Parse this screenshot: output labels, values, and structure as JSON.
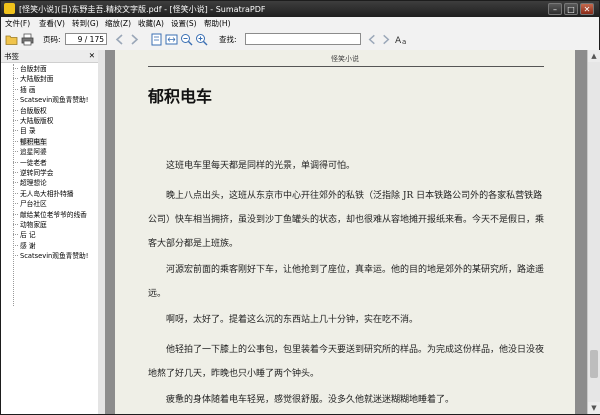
{
  "window": {
    "title": "[怪笑小说](日)东野圭吾.精校文字版.pdf - [怪笑小说] - SumatraPDF"
  },
  "menu": [
    "文件(F)",
    "查看(V)",
    "转到(G)",
    "缩放(Z)",
    "收藏(A)",
    "设置(S)",
    "帮助(H)"
  ],
  "toolbar": {
    "page_label": "页码:",
    "page_value": "9 / 175",
    "find_label": "查找:",
    "find_value": ""
  },
  "sidebar": {
    "title": "书签",
    "items": [
      {
        "label": "台版封面"
      },
      {
        "label": "大陆版封面"
      },
      {
        "label": "插 画"
      },
      {
        "label": "Scatsevin观鱼青赞助!"
      },
      {
        "label": "台版版权"
      },
      {
        "label": "大陆版版权"
      },
      {
        "label": "目 录"
      },
      {
        "label": "郁积电车",
        "selected": true
      },
      {
        "label": "追星阿婆"
      },
      {
        "label": "一徒老者"
      },
      {
        "label": "逆转同学会"
      },
      {
        "label": "超理想论"
      },
      {
        "label": "无人岛大相扑特播"
      },
      {
        "label": "尸台社区"
      },
      {
        "label": "献给某位老爷爷的线香"
      },
      {
        "label": "动物家庭"
      },
      {
        "label": "后 记"
      },
      {
        "label": "感 谢"
      },
      {
        "label": "Scatsevin观鱼青赞助!"
      }
    ]
  },
  "document": {
    "running_head": "怪笑小说",
    "chapter_title": "郁积电车",
    "paragraphs": [
      "这班电车里每天都是同样的光景，单调得可怕。",
      "晚上八点出头，这班从东京市中心开往郊外的私铁（泛指除 JR 日本铁路公司外的各家私营铁路公司）快车相当拥挤，虽没到沙丁鱼罐头的状态，却也很难从容地摊开报纸来看。今天不是假日，乘客大部分都是上班族。",
      "河源宏前面的乘客刚好下车，让他抢到了座位，真幸运。他的目的地是郊外的某研究所，路途遥远。",
      "啊呀，太好了。提着这么沉的东西站上几十分钟，实在吃不消。",
      "他轻拍了一下膝上的公事包，包里装着今天要送到研究所的样品。为完成这份样品，他没日没夜地熬了好几天，昨晚也只小睡了两个钟头。",
      "疲惫的身体随着电车轻晃，感觉很舒服。没多久他就迷迷糊糊地睡着了。"
    ]
  }
}
